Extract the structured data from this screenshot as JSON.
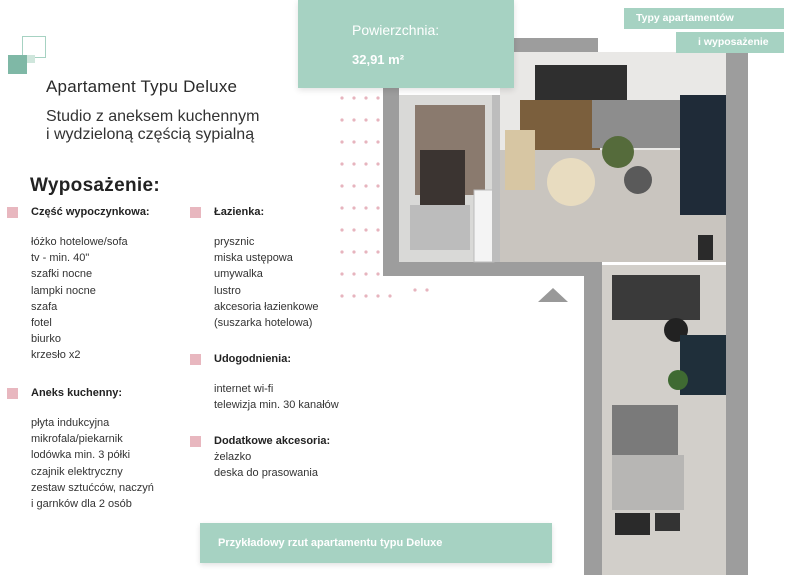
{
  "header": {
    "title": "Apartament Typu Deluxe",
    "subtitle_line1": "Studio z aneksem kuchennym",
    "subtitle_line2": "i wydzieloną częścią sypialną"
  },
  "area": {
    "label": "Powierzchnia:",
    "value": "32,91 m²"
  },
  "tags": {
    "line1": "Typy apartamentów",
    "line2": "i wyposażenie"
  },
  "equipment": {
    "heading": "Wyposażenie:",
    "categories": [
      {
        "name": "Część wypoczynkowa:",
        "items": [
          "łóżko hotelowe/sofa",
          "tv - min. 40\"",
          "szafki nocne",
          "lampki nocne",
          "szafa",
          "fotel",
          "biurko",
          "krzesło x2"
        ]
      },
      {
        "name": "Aneks kuchenny:",
        "items": [
          "płyta indukcyjna",
          "mikrofala/piekarnik",
          "lodówka min. 3 półki",
          "czajnik elektryczny",
          "zestaw sztućców, naczyń",
          "i garnków dla 2 osób"
        ]
      },
      {
        "name": "Łazienka:",
        "items": [
          "prysznic",
          "miska ustępowa",
          "umywalka",
          "lustro",
          "akcesoria łazienkowe",
          "(suszarka hotelowa)"
        ]
      },
      {
        "name": "Udogodnienia:",
        "items": [
          "internet wi-fi",
          "telewizja min. 30 kanałów"
        ]
      },
      {
        "name": "Dodatkowe akcesoria:",
        "items": [
          "żelazko",
          "deska do prasowania"
        ]
      }
    ]
  },
  "caption": "Przykładowy rzut apartamentu typu Deluxe",
  "colors": {
    "accent": "#a6d2c2",
    "bullet": "#e8b7bf",
    "logo_dark": "#7fb8a6",
    "wall": "#9b9b9b"
  },
  "icons": {
    "logo": "brand-squares-icon",
    "bullet": "pink-square-bullet-icon",
    "arrow": "triangle-up-icon"
  }
}
